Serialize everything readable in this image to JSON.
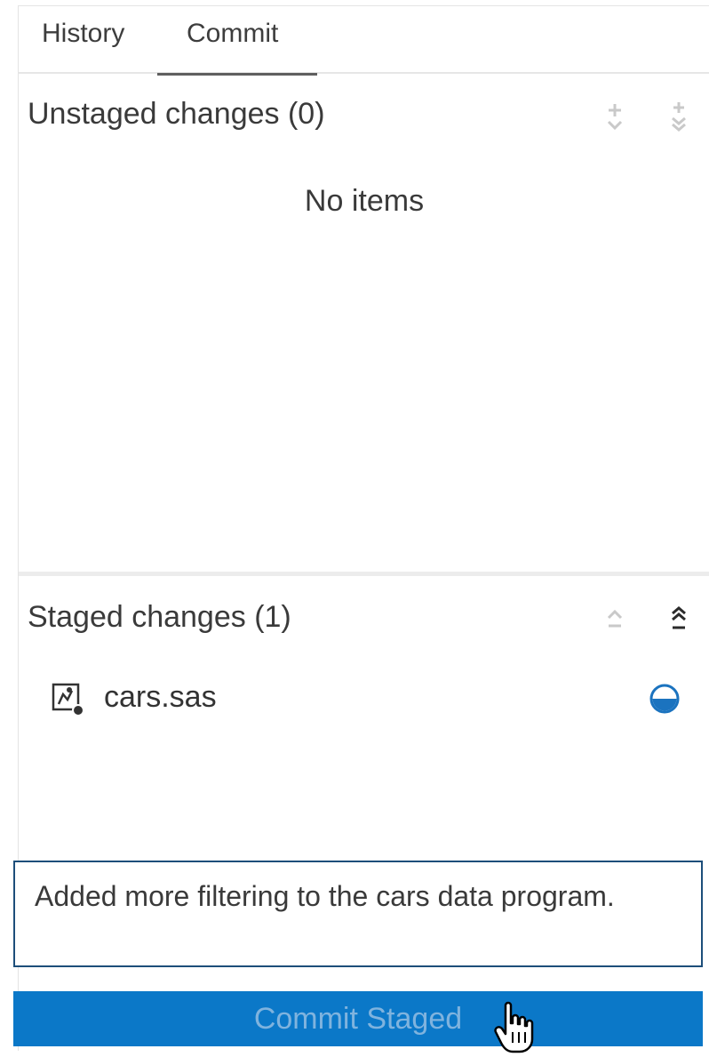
{
  "tabs": {
    "history": "History",
    "commit": "Commit",
    "active": "Commit"
  },
  "unstaged": {
    "title": "Unstaged changes (0)",
    "empty_text": "No items",
    "actions": [
      {
        "icon": "stage-icon"
      },
      {
        "icon": "stage-all-icon"
      }
    ]
  },
  "staged": {
    "title": "Staged changes (1)",
    "actions": [
      {
        "icon": "unstage-icon"
      },
      {
        "icon": "unstage-all-icon"
      }
    ],
    "items": [
      {
        "name": "cars.sas",
        "icon": "sas-program-icon",
        "action_icon": "unstage-item-icon"
      }
    ]
  },
  "commit_message": {
    "value": "Added more filtering to the cars data program."
  },
  "commit_button": {
    "label": "Commit Staged",
    "enabled": false
  },
  "colors": {
    "accent": "#0b78c8",
    "button_text_disabled": "#7fb3de",
    "focus_border": "#1d4e7a"
  }
}
